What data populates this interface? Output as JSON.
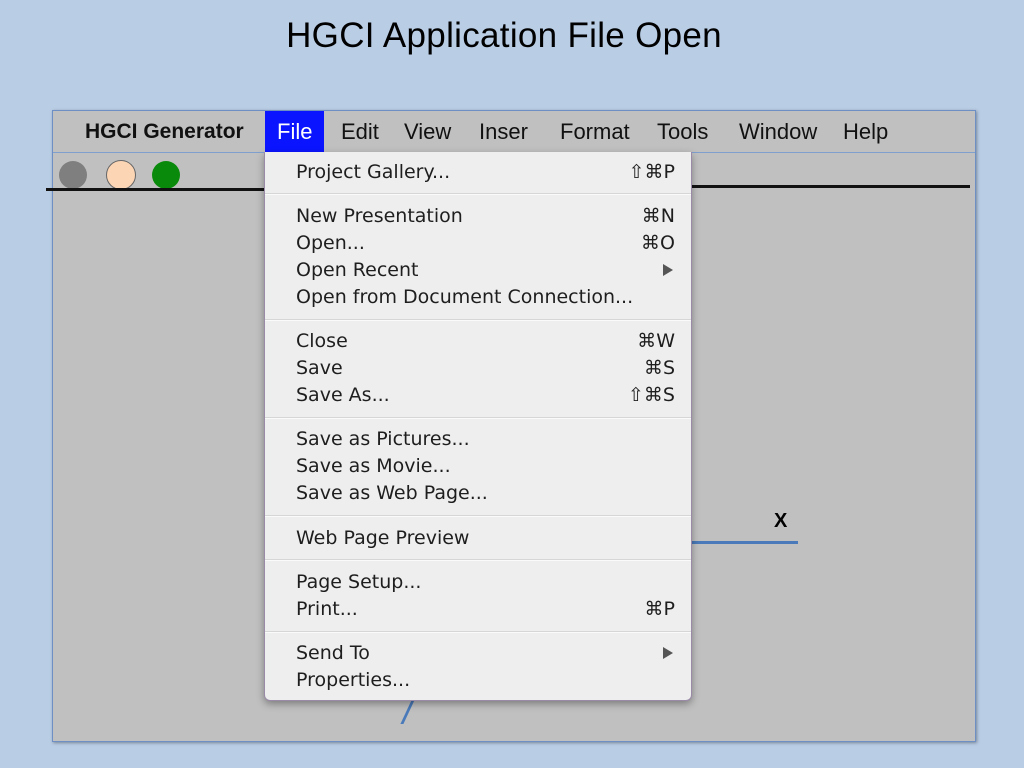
{
  "slide": {
    "title": "HGCI Application File Open"
  },
  "menubar": {
    "app_name": "HGCI Generator",
    "items": [
      "File",
      "Edit",
      "View",
      "Inser",
      "Format",
      "Tools",
      "Window",
      "Help"
    ],
    "active": "File"
  },
  "window_controls": [
    "grey-button-icon",
    "peach-button-icon",
    "green-button-icon"
  ],
  "axes": {
    "x_label": "X"
  },
  "file_menu": {
    "items": [
      {
        "label": "Project Gallery...",
        "shortcut": "⇧⌘P"
      },
      {
        "label": "New Presentation",
        "shortcut": "⌘N"
      },
      {
        "label": "Open...",
        "shortcut": "⌘O"
      },
      {
        "label": "Open Recent",
        "shortcut": "",
        "submenu": true
      },
      {
        "label": "Open from Document Connection...",
        "shortcut": ""
      },
      {
        "label": "Close",
        "shortcut": "⌘W"
      },
      {
        "label": "Save",
        "shortcut": "⌘S"
      },
      {
        "label": "Save As...",
        "shortcut": "⇧⌘S"
      },
      {
        "label": "Save as Pictures...",
        "shortcut": ""
      },
      {
        "label": "Save as Movie...",
        "shortcut": ""
      },
      {
        "label": "Save as Web Page...",
        "shortcut": ""
      },
      {
        "label": "Web Page Preview",
        "shortcut": ""
      },
      {
        "label": "Page Setup...",
        "shortcut": ""
      },
      {
        "label": "Print...",
        "shortcut": "⌘P"
      },
      {
        "label": "Send To",
        "shortcut": "",
        "submenu": true
      },
      {
        "label": "Properties...",
        "shortcut": ""
      }
    ]
  },
  "colors": {
    "slide_background": "#b9cde5",
    "window_background": "#c0c0c0",
    "active_menu": "#0a14ff",
    "axis": "#4a7ab9"
  }
}
